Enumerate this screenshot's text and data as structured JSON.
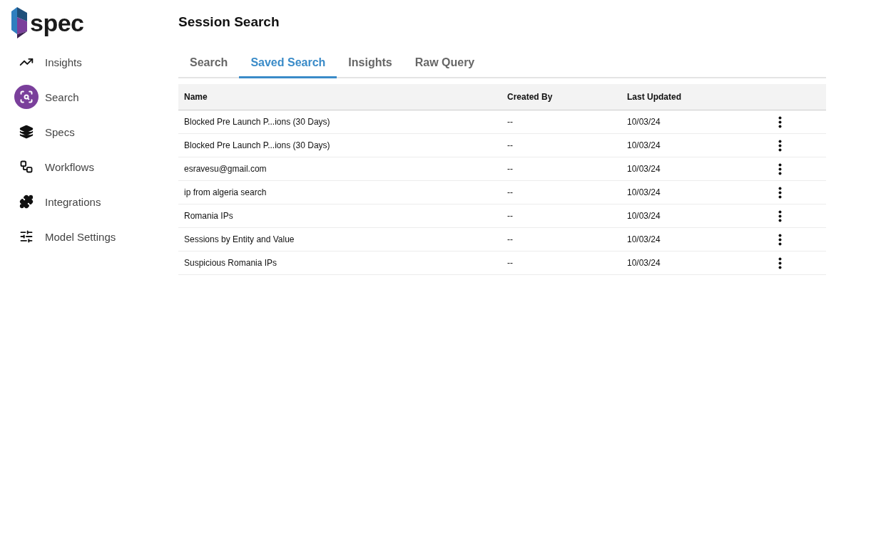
{
  "logo": {
    "text": "spec"
  },
  "sidebar": {
    "items": [
      {
        "label": "Insights",
        "selected": false
      },
      {
        "label": "Search",
        "selected": true
      },
      {
        "label": "Specs",
        "selected": false
      },
      {
        "label": "Workflows",
        "selected": false
      },
      {
        "label": "Integrations",
        "selected": false
      },
      {
        "label": "Model Settings",
        "selected": false
      }
    ]
  },
  "page": {
    "title": "Session Search"
  },
  "tabs": [
    {
      "label": "Search",
      "selected": false
    },
    {
      "label": "Saved Search",
      "selected": true
    },
    {
      "label": "Insights",
      "selected": false
    },
    {
      "label": "Raw Query",
      "selected": false
    }
  ],
  "table": {
    "columns": [
      "Name",
      "Created By",
      "Last Updated"
    ],
    "rows": [
      {
        "name": "Blocked Pre Launch P...ions (30 Days)",
        "created_by": "--",
        "last_updated": "10/03/24"
      },
      {
        "name": "Blocked Pre Launch P...ions (30 Days)",
        "created_by": "--",
        "last_updated": "10/03/24"
      },
      {
        "name": "esravesu@gmail.com",
        "created_by": "--",
        "last_updated": "10/03/24"
      },
      {
        "name": "ip from algeria search",
        "created_by": "--",
        "last_updated": "10/03/24"
      },
      {
        "name": "Romania IPs",
        "created_by": "--",
        "last_updated": "10/03/24"
      },
      {
        "name": "Sessions by Entity and Value",
        "created_by": "--",
        "last_updated": "10/03/24"
      },
      {
        "name": "Suspicious Romania IPs",
        "created_by": "--",
        "last_updated": "10/03/24"
      }
    ]
  }
}
